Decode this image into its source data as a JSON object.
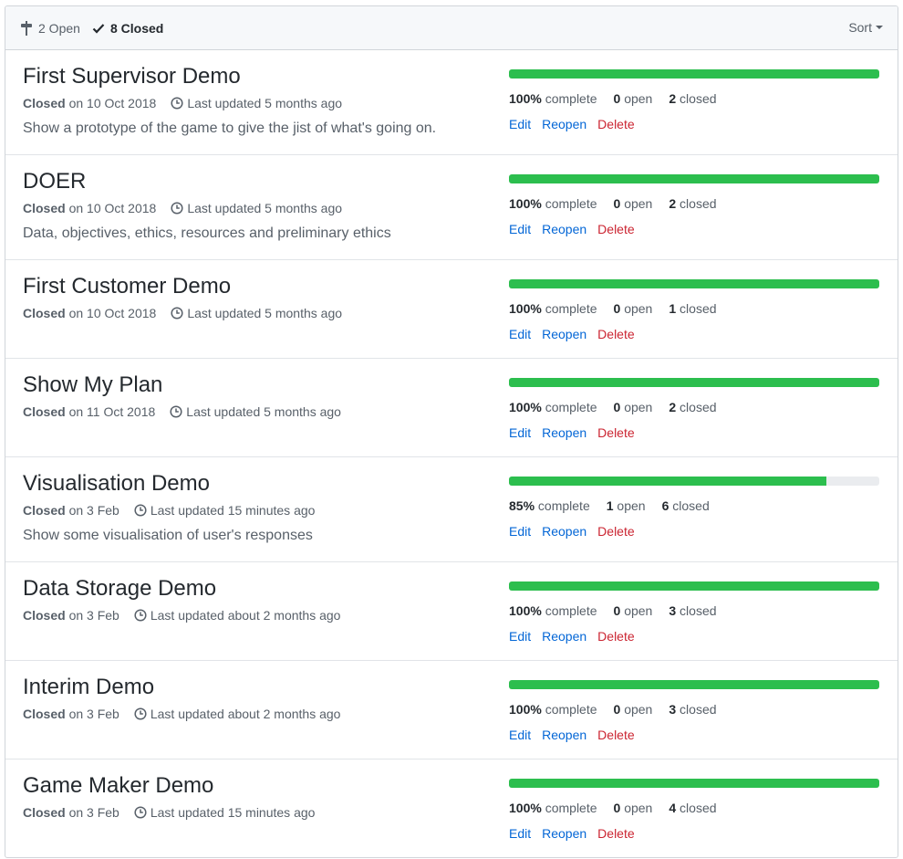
{
  "header": {
    "open_count_label": "2 Open",
    "closed_count_label": "8 Closed",
    "sort_label": "Sort"
  },
  "colors": {
    "progress_fill": "#2cbe4e",
    "progress_track": "#eaecef",
    "link": "#0366d6",
    "danger": "#cb2431"
  },
  "labels": {
    "closed_word": "Closed",
    "complete_word": "complete",
    "open_word": "open",
    "closed_word_lower": "closed",
    "edit": "Edit",
    "reopen": "Reopen",
    "delete": "Delete"
  },
  "milestones": [
    {
      "title": "First Supervisor Demo",
      "closed_on": "on 10 Oct 2018",
      "updated": "Last updated 5 months ago",
      "description": "Show a prototype of the game to give the jist of what's going on.",
      "percent": "100%",
      "progress": 1.0,
      "open": "0",
      "closed": "2"
    },
    {
      "title": "DOER",
      "closed_on": "on 10 Oct 2018",
      "updated": "Last updated 5 months ago",
      "description": "Data, objectives, ethics, resources and preliminary ethics",
      "percent": "100%",
      "progress": 1.0,
      "open": "0",
      "closed": "2"
    },
    {
      "title": "First Customer Demo",
      "closed_on": "on 10 Oct 2018",
      "updated": "Last updated 5 months ago",
      "description": "",
      "percent": "100%",
      "progress": 1.0,
      "open": "0",
      "closed": "1"
    },
    {
      "title": "Show My Plan",
      "closed_on": "on 11 Oct 2018",
      "updated": "Last updated 5 months ago",
      "description": "",
      "percent": "100%",
      "progress": 1.0,
      "open": "0",
      "closed": "2"
    },
    {
      "title": "Visualisation Demo",
      "closed_on": "on 3 Feb",
      "updated": "Last updated 15 minutes ago",
      "description": "Show some visualisation of user's responses",
      "percent": "85%",
      "progress": 0.857,
      "open": "1",
      "closed": "6"
    },
    {
      "title": "Data Storage Demo",
      "closed_on": "on 3 Feb",
      "updated": "Last updated about 2 months ago",
      "description": "",
      "percent": "100%",
      "progress": 1.0,
      "open": "0",
      "closed": "3"
    },
    {
      "title": "Interim Demo",
      "closed_on": "on 3 Feb",
      "updated": "Last updated about 2 months ago",
      "description": "",
      "percent": "100%",
      "progress": 1.0,
      "open": "0",
      "closed": "3"
    },
    {
      "title": "Game Maker Demo",
      "closed_on": "on 3 Feb",
      "updated": "Last updated 15 minutes ago",
      "description": "",
      "percent": "100%",
      "progress": 1.0,
      "open": "0",
      "closed": "4"
    }
  ]
}
